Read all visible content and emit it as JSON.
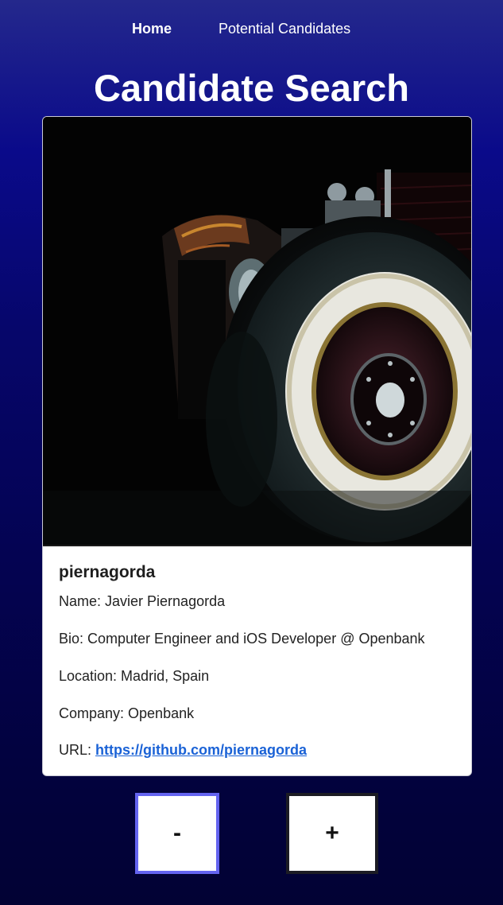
{
  "nav": {
    "home_label": "Home",
    "candidates_label": "Potential Candidates"
  },
  "page": {
    "title": "Candidate Search"
  },
  "candidate": {
    "username": "piernagorda",
    "name_line": "Name: Javier Piernagorda",
    "bio_line": "Bio: Computer Engineer and iOS Developer @ Openbank",
    "location_line": "Location: Madrid, Spain",
    "company_line": "Company: Openbank",
    "url_prefix": "URL: ",
    "url": "https://github.com/piernagorda",
    "avatar_icon": "hot-rod-wheel-photo"
  },
  "actions": {
    "reject_label": "-",
    "accept_label": "+"
  },
  "colors": {
    "background_top": "#24288c",
    "background_bottom": "#020234",
    "link": "#1a62d6",
    "reject_border": "#6464f0",
    "accept_border": "#1c1c24"
  }
}
